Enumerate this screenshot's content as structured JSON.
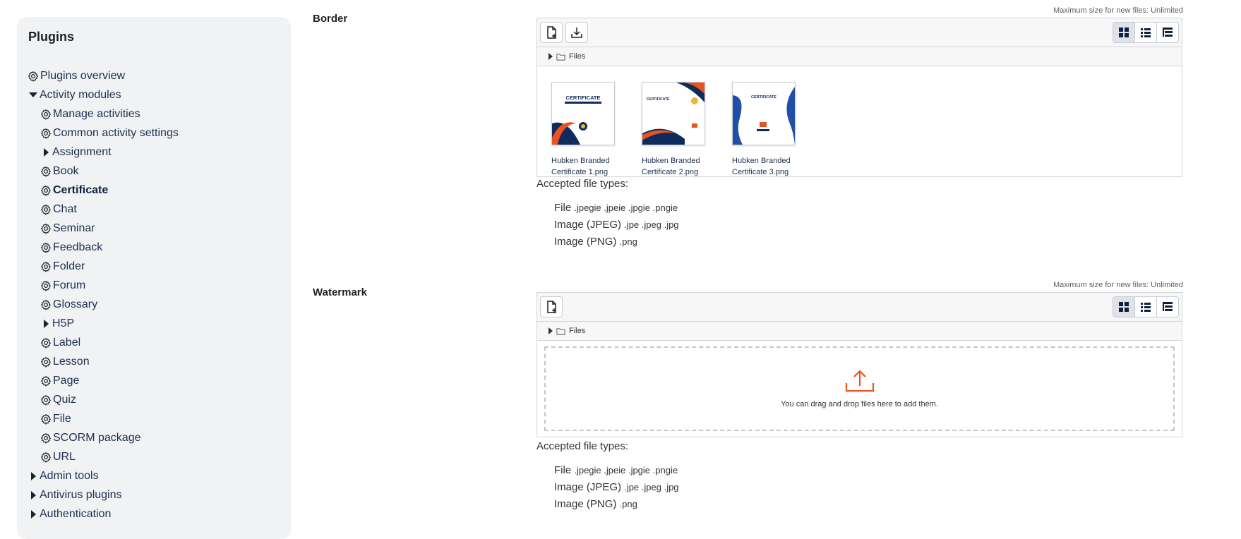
{
  "sidebar": {
    "title": "Plugins",
    "items": [
      {
        "label": "Plugins overview",
        "level": 1,
        "icon": "gear-icon"
      },
      {
        "label": "Activity modules",
        "level": 1,
        "icon": "caret-down-icon"
      },
      {
        "label": "Manage activities",
        "level": 2,
        "icon": "gear-icon"
      },
      {
        "label": "Common activity settings",
        "level": 2,
        "icon": "gear-icon"
      },
      {
        "label": "Assignment",
        "level": 2,
        "icon": "caret-right-icon"
      },
      {
        "label": "Book",
        "level": 2,
        "icon": "gear-icon"
      },
      {
        "label": "Certificate",
        "level": 2,
        "icon": "gear-icon",
        "active": true
      },
      {
        "label": "Chat",
        "level": 2,
        "icon": "gear-icon"
      },
      {
        "label": "Seminar",
        "level": 2,
        "icon": "gear-icon"
      },
      {
        "label": "Feedback",
        "level": 2,
        "icon": "gear-icon"
      },
      {
        "label": "Folder",
        "level": 2,
        "icon": "gear-icon"
      },
      {
        "label": "Forum",
        "level": 2,
        "icon": "gear-icon"
      },
      {
        "label": "Glossary",
        "level": 2,
        "icon": "gear-icon"
      },
      {
        "label": "H5P",
        "level": 2,
        "icon": "caret-right-icon"
      },
      {
        "label": "Label",
        "level": 2,
        "icon": "gear-icon"
      },
      {
        "label": "Lesson",
        "level": 2,
        "icon": "gear-icon"
      },
      {
        "label": "Page",
        "level": 2,
        "icon": "gear-icon"
      },
      {
        "label": "Quiz",
        "level": 2,
        "icon": "gear-icon"
      },
      {
        "label": "File",
        "level": 2,
        "icon": "gear-icon"
      },
      {
        "label": "SCORM package",
        "level": 2,
        "icon": "gear-icon"
      },
      {
        "label": "URL",
        "level": 2,
        "icon": "gear-icon"
      },
      {
        "label": "Admin tools",
        "level": 1,
        "icon": "caret-right-icon"
      },
      {
        "label": "Antivirus plugins",
        "level": 1,
        "icon": "caret-right-icon"
      },
      {
        "label": "Authentication",
        "level": 1,
        "icon": "caret-right-icon"
      }
    ]
  },
  "border": {
    "label": "Border",
    "max_size": "Maximum size for new files: Unlimited",
    "path_label": "Files",
    "files": [
      {
        "name_line1": "Hubken Branded",
        "name_line2": "Certificate 1.png"
      },
      {
        "name_line1": "Hubken Branded",
        "name_line2": "Certificate 2.png"
      },
      {
        "name_line1": "Hubken Branded",
        "name_line2": "Certificate 3.png"
      }
    ],
    "accepted_label": "Accepted file types:",
    "types": [
      {
        "name": "File",
        "exts": ".jpegie .jpeie .jpgie .pngie"
      },
      {
        "name": "Image (JPEG)",
        "exts": ".jpe .jpeg .jpg"
      },
      {
        "name": "Image (PNG)",
        "exts": ".png"
      }
    ]
  },
  "watermark": {
    "label": "Watermark",
    "max_size": "Maximum size for new files: Unlimited",
    "path_label": "Files",
    "drop_text": "You can drag and drop files here to add them.",
    "accepted_label": "Accepted file types:",
    "types": [
      {
        "name": "File",
        "exts": ".jpegie .jpeie .jpgie .pngie"
      },
      {
        "name": "Image (JPEG)",
        "exts": ".jpe .jpeg .jpg"
      },
      {
        "name": "Image (PNG)",
        "exts": ".png"
      }
    ]
  },
  "thumb_text": {
    "t1": "CERTIFICATE",
    "t2": "CERTIFICATE",
    "t3": "CERTIFICATE"
  },
  "colors": {
    "accent_navy": "#0f2a5c",
    "accent_orange": "#e8531f",
    "upload_icon": "#e8531f"
  }
}
